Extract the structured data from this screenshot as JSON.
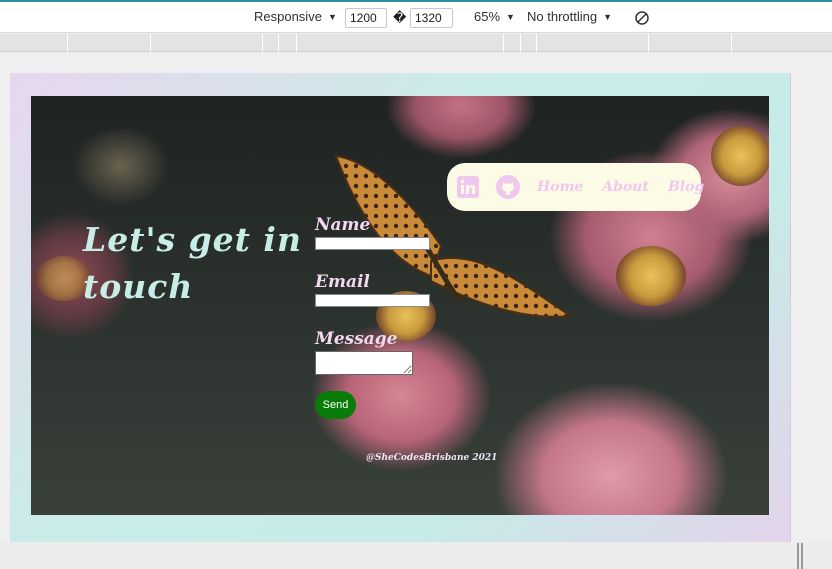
{
  "devtools": {
    "device_mode": "Responsive",
    "width": "1200",
    "height": "1320",
    "zoom": "65%",
    "throttling": "No throttling",
    "swap_glyph": "�"
  },
  "page": {
    "heading": "Let's get in touch",
    "nav": {
      "icons": [
        "linkedin-icon",
        "github-icon"
      ],
      "links": [
        "Home",
        "About",
        "Blog"
      ]
    },
    "form": {
      "name_label": "Name",
      "email_label": "Email",
      "message_label": "Message",
      "name_value": "",
      "email_value": "",
      "message_value": "",
      "send_label": "Send"
    },
    "footer": "@SheCodesBrisbane 2021",
    "colors": {
      "heading": "#c8ece6",
      "labels": "#f3d8f0",
      "nav_bg": "#fcfbe6",
      "nav_links": "#f0c7ee",
      "send_button": "#087b08"
    }
  }
}
